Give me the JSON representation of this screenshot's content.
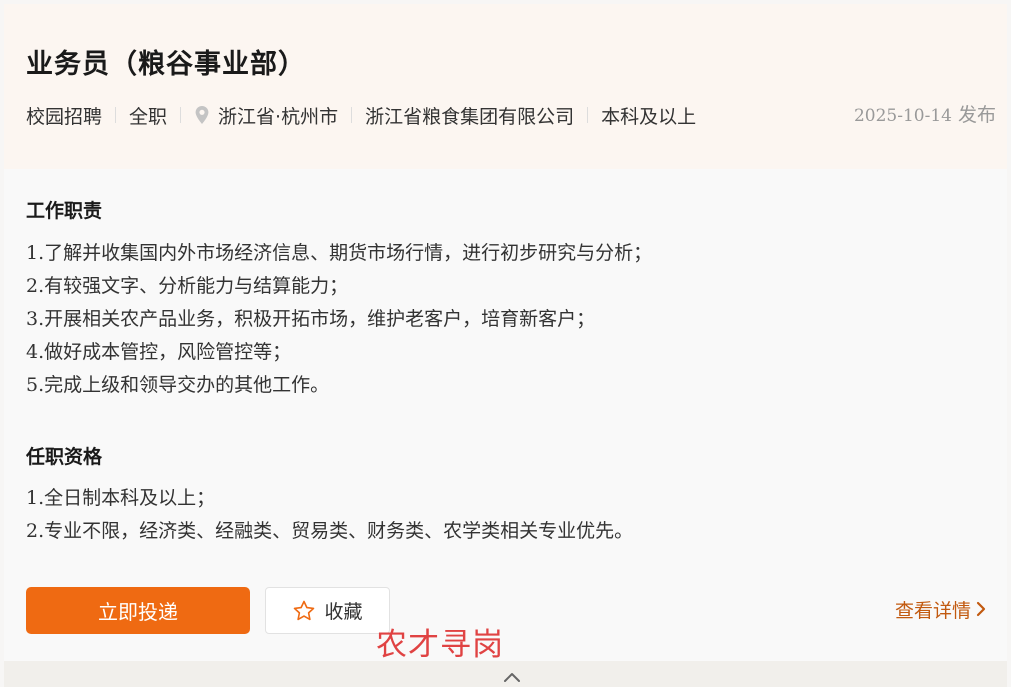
{
  "job": {
    "title": "业务员（粮谷事业部）",
    "meta": {
      "recruit_type": "校园招聘",
      "employment_type": "全职",
      "location": "浙江省·杭州市",
      "company": "浙江省粮食集团有限公司",
      "education": "本科及以上"
    },
    "publish_date": "2025-10-14",
    "publish_suffix": " 发布"
  },
  "responsibilities": {
    "title": "工作职责",
    "items": [
      {
        "num": "1.",
        "text": "了解并收集国内外市场经济信息、期货市场行情，进行初步研究与分析；"
      },
      {
        "num": "2.",
        "text": "有较强文字、分析能力与结算能力；"
      },
      {
        "num": "3.",
        "text": "开展相关农产品业务，积极开拓市场，维护老客户，培育新客户；"
      },
      {
        "num": "4.",
        "text": "做好成本管控，风险管控等；"
      },
      {
        "num": "5.",
        "text": "完成上级和领导交办的其他工作。"
      }
    ]
  },
  "qualifications": {
    "title": "任职资格",
    "items": [
      {
        "num": "1.",
        "text": "全日制本科及以上；"
      },
      {
        "num": "2.",
        "text": "专业不限，经济类、经融类、贸易类、财务类、农学类相关专业优先。"
      }
    ]
  },
  "actions": {
    "apply_label": "立即投递",
    "favorite_label": "收藏",
    "details_label": "查看详情"
  },
  "icons": {
    "location": "location-pin-icon",
    "favorite": "star-outline-icon",
    "details": "chevron-right-icon",
    "collapse": "chevron-up-icon"
  },
  "colors": {
    "accent": "#ef6a12",
    "link": "#c25a10",
    "watermark": "#e04343"
  },
  "watermark": "农才寻岗"
}
